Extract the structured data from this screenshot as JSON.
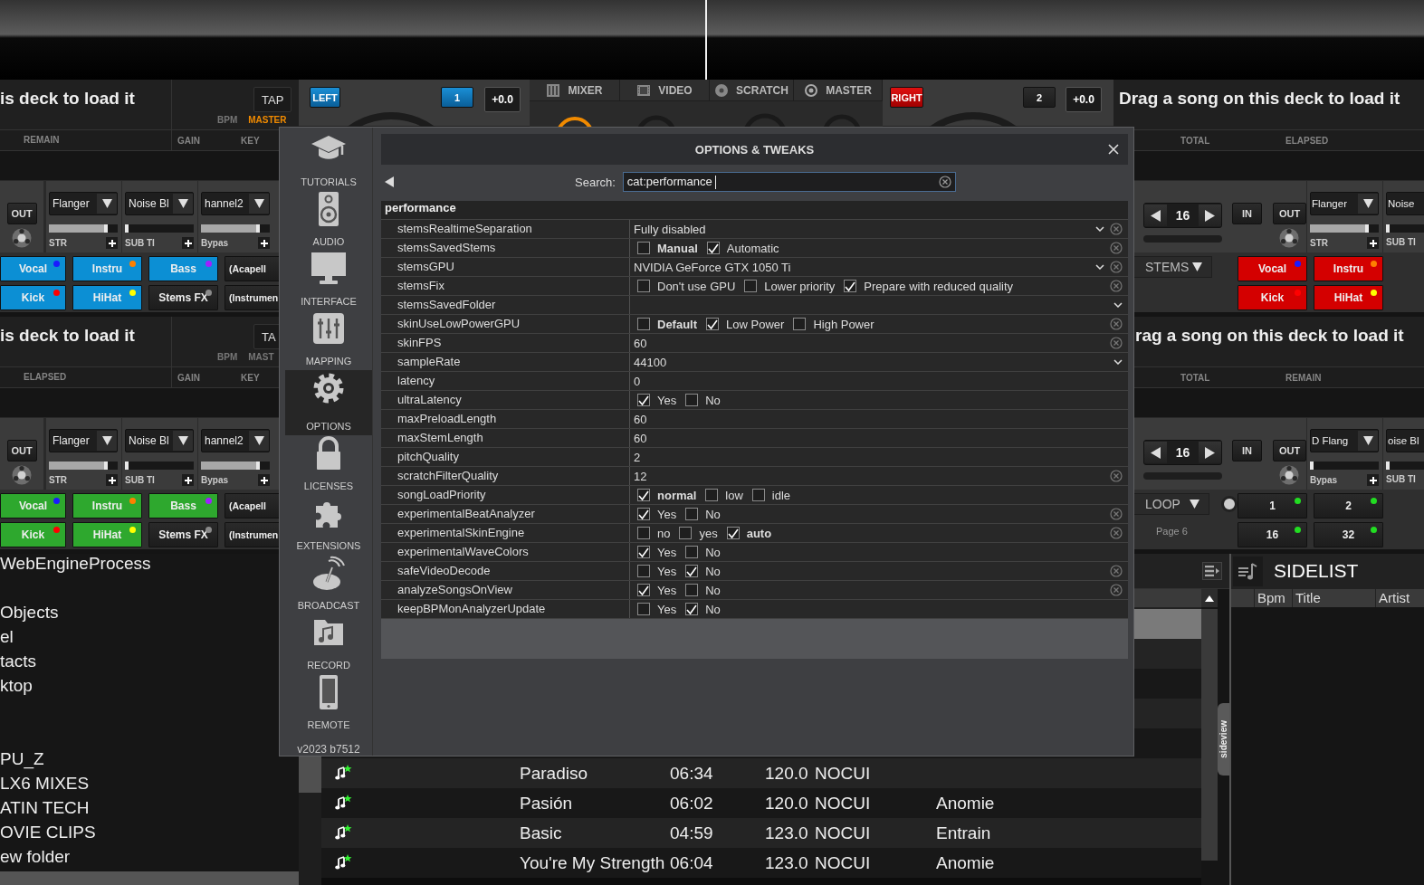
{
  "decks": [
    {
      "color": "#0c8fd4",
      "title": "is deck to load it",
      "tap": "TAP",
      "bpm_label": "BPM",
      "master": "MASTER",
      "master_on": true,
      "time_labels": [
        "REMAIN",
        "GAIN",
        "KEY"
      ],
      "out": "OUT",
      "effects": [
        {
          "name": "Flanger",
          "param": "STR",
          "level": 0.85
        },
        {
          "name": "Noise Bl",
          "param": "SUB TI",
          "level": 0.0
        },
        {
          "name": "hannel2",
          "param": "Bypas",
          "level": 0.85
        }
      ],
      "pads": [
        {
          "label": "Vocal",
          "on": true,
          "color": "#1a1aff"
        },
        {
          "label": "Instru",
          "on": true,
          "color": "#ff8000"
        },
        {
          "label": "Bass",
          "on": true,
          "color": "#a020ff"
        },
        {
          "label": "(Acapell",
          "on": false
        },
        {
          "label": "Kick",
          "on": true,
          "color": "#ff0000"
        },
        {
          "label": "HiHat",
          "on": true,
          "color": "#ffff00"
        },
        {
          "label": "Stems FX",
          "on": false,
          "color": "#8a8a8a"
        },
        {
          "label": "(Instrumen",
          "on": false
        }
      ]
    },
    {
      "color": "#d40000",
      "title": "Drag a song on this deck to load it",
      "time_labels": [
        "TOTAL",
        "ELAPSED"
      ],
      "loop_value": "16",
      "in": "IN",
      "out": "OUT",
      "effects": [
        {
          "name": "Flanger",
          "param": "STR",
          "level": 0.85
        },
        {
          "name": "Noise",
          "param": "SUB TI",
          "level": 0.0
        }
      ],
      "pad_mode": "STEMS",
      "pads": [
        {
          "label": "Vocal",
          "on": true,
          "color": "#1a1aff"
        },
        {
          "label": "Instru",
          "on": true,
          "color": "#ff8000"
        },
        {
          "label": "Kick",
          "on": true,
          "color": "#ff0000"
        },
        {
          "label": "HiHat",
          "on": true,
          "color": "#ffff00"
        }
      ]
    },
    {
      "color": "#2ea82e",
      "title": "is deck to load it",
      "tap": "TA",
      "bpm_label": "BPM",
      "master": "MAST",
      "master_on": false,
      "time_labels": [
        "ELAPSED",
        "GAIN",
        "KEY"
      ],
      "out": "OUT",
      "effects": [
        {
          "name": "Flanger",
          "param": "STR",
          "level": 0.85
        },
        {
          "name": "Noise Bl",
          "param": "SUB TI",
          "level": 0.0
        },
        {
          "name": "hannel2",
          "param": "Bypas",
          "level": 0.85
        }
      ],
      "pads": [
        {
          "label": "Vocal",
          "on": true,
          "color": "#1a1aff"
        },
        {
          "label": "Instru",
          "on": true,
          "color": "#ff8000"
        },
        {
          "label": "Bass",
          "on": true,
          "color": "#a020ff"
        },
        {
          "label": "(Acapell",
          "on": false
        },
        {
          "label": "Kick",
          "on": true,
          "color": "#ff0000"
        },
        {
          "label": "HiHat",
          "on": true,
          "color": "#ffff00"
        },
        {
          "label": "Stems FX",
          "on": false,
          "color": "#8a8a8a"
        },
        {
          "label": "(Instrumen",
          "on": false
        }
      ]
    },
    {
      "title": "rag a song on this deck to load it",
      "time_labels": [
        "TOTAL",
        "REMAIN"
      ],
      "loop_value": "16",
      "in": "IN",
      "out": "OUT",
      "effects": [
        {
          "name": "D Flang",
          "param": "Bypas",
          "level": 0.0
        },
        {
          "name": "oise Bl",
          "param": "SUB TI",
          "level": 0.0
        }
      ],
      "pad_mode": "LOOP",
      "radio_on": true,
      "page_label": "Page 6",
      "pads": [
        {
          "label": "1",
          "on": false,
          "color": "#22dd22"
        },
        {
          "label": "2",
          "on": false,
          "color": "#22dd22"
        },
        {
          "label": "16",
          "on": false,
          "color": "#22dd22"
        },
        {
          "label": "32",
          "on": false,
          "color": "#22dd22"
        }
      ]
    }
  ],
  "mixer": {
    "left": "LEFT",
    "right": "RIGHT",
    "deck_buttons": [
      {
        "label": "1",
        "on": true
      },
      {
        "label": "2",
        "on": false
      }
    ],
    "pitch": [
      "+0.0",
      "+0.0"
    ],
    "tabs": [
      {
        "label": "MIXER",
        "kind": "mixer",
        "selected": false
      },
      {
        "label": "VIDEO",
        "kind": "video",
        "selected": false
      },
      {
        "label": "SCRATCH",
        "kind": "scratch",
        "selected": false
      },
      {
        "label": "MASTER",
        "kind": "master",
        "selected": false
      }
    ]
  },
  "options": {
    "nav": [
      {
        "label": "TUTORIALS",
        "kind": "tutorials",
        "selected": false
      },
      {
        "label": "AUDIO",
        "kind": "audio",
        "selected": false
      },
      {
        "label": "INTERFACE",
        "kind": "interface",
        "selected": false
      },
      {
        "label": "MAPPING",
        "kind": "mapping",
        "selected": false
      },
      {
        "label": "OPTIONS",
        "kind": "options",
        "selected": true
      },
      {
        "label": "LICENSES",
        "kind": "licenses",
        "selected": false
      },
      {
        "label": "EXTENSIONS",
        "kind": "extensions",
        "selected": false
      },
      {
        "label": "BROADCAST",
        "kind": "broadcast",
        "selected": false
      },
      {
        "label": "RECORD",
        "kind": "record",
        "selected": false
      },
      {
        "label": "REMOTE",
        "kind": "remote",
        "selected": false
      }
    ],
    "version": "v2023 b7512",
    "title": "OPTIONS & TWEAKS",
    "search": {
      "label": "Search:",
      "value": "cat:performance"
    },
    "category": "performance",
    "settings": [
      {
        "name": "stemsRealtimeSeparation",
        "kind": "select",
        "value": "Fully disabled",
        "resettable": true
      },
      {
        "name": "stemsSavedStems",
        "kind": "choices",
        "choices": [
          {
            "label": "Manual",
            "default": true,
            "checked": false
          },
          {
            "label": "Automatic",
            "default": false,
            "checked": true
          }
        ],
        "resettable": true
      },
      {
        "name": "stemsGPU",
        "kind": "select",
        "value": "NVIDIA GeForce GTX 1050 Ti",
        "resettable": true
      },
      {
        "name": "stemsFix",
        "kind": "choices",
        "choices": [
          {
            "label": "Don't use GPU",
            "default": false,
            "checked": false
          },
          {
            "label": "Lower priority",
            "default": false,
            "checked": false
          },
          {
            "label": "Prepare with reduced quality",
            "default": false,
            "checked": true
          }
        ],
        "resettable": true
      },
      {
        "name": "stemsSavedFolder",
        "kind": "select",
        "resettable": false
      },
      {
        "name": "skinUseLowPowerGPU",
        "kind": "choices",
        "choices": [
          {
            "label": "Default",
            "default": true,
            "checked": false
          },
          {
            "label": "Low Power",
            "default": false,
            "checked": true
          },
          {
            "label": "High Power",
            "default": false,
            "checked": false
          }
        ],
        "resettable": true
      },
      {
        "name": "skinFPS",
        "kind": "text",
        "value": "60",
        "resettable": true
      },
      {
        "name": "sampleRate",
        "kind": "select",
        "value": "44100",
        "resettable": false
      },
      {
        "name": "latency",
        "kind": "text",
        "value": "0",
        "resettable": false
      },
      {
        "name": "ultraLatency",
        "kind": "choices",
        "choices": [
          {
            "label": "Yes",
            "default": false,
            "checked": true
          },
          {
            "label": "No",
            "default": false,
            "checked": false
          }
        ],
        "resettable": false
      },
      {
        "name": "maxPreloadLength",
        "kind": "text",
        "value": "60",
        "resettable": false
      },
      {
        "name": "maxStemLength",
        "kind": "text",
        "value": "60",
        "resettable": false
      },
      {
        "name": "pitchQuality",
        "kind": "text",
        "value": "2",
        "resettable": false
      },
      {
        "name": "scratchFilterQuality",
        "kind": "text",
        "value": "12",
        "resettable": true
      },
      {
        "name": "songLoadPriority",
        "kind": "choices",
        "choices": [
          {
            "label": "normal",
            "default": true,
            "checked": true
          },
          {
            "label": "low",
            "default": false,
            "checked": false
          },
          {
            "label": "idle",
            "default": false,
            "checked": false
          }
        ],
        "resettable": false
      },
      {
        "name": "experimentalBeatAnalyzer",
        "kind": "choices",
        "choices": [
          {
            "label": "Yes",
            "default": false,
            "checked": true
          },
          {
            "label": "No",
            "default": false,
            "checked": false
          }
        ],
        "resettable": true
      },
      {
        "name": "experimentalSkinEngine",
        "kind": "choices",
        "choices": [
          {
            "label": "no",
            "default": false,
            "checked": false
          },
          {
            "label": "yes",
            "default": false,
            "checked": false
          },
          {
            "label": "auto",
            "default": true,
            "checked": true
          }
        ],
        "resettable": true
      },
      {
        "name": "experimentalWaveColors",
        "kind": "choices",
        "choices": [
          {
            "label": "Yes",
            "default": false,
            "checked": true
          },
          {
            "label": "No",
            "default": false,
            "checked": false
          }
        ],
        "resettable": false
      },
      {
        "name": "safeVideoDecode",
        "kind": "choices",
        "choices": [
          {
            "label": "Yes",
            "default": false,
            "checked": false
          },
          {
            "label": "No",
            "default": false,
            "checked": true
          }
        ],
        "resettable": true
      },
      {
        "name": "analyzeSongsOnView",
        "kind": "choices",
        "choices": [
          {
            "label": "Yes",
            "default": false,
            "checked": true
          },
          {
            "label": "No",
            "default": false,
            "checked": false
          }
        ],
        "resettable": true
      },
      {
        "name": "keepBPMonAnalyzerUpdate",
        "kind": "choices",
        "choices": [
          {
            "label": "Yes",
            "default": false,
            "checked": false
          },
          {
            "label": "No",
            "default": false,
            "checked": true
          }
        ],
        "resettable": false
      }
    ]
  },
  "browser": {
    "folders": [
      {
        "label": "WebEngineProcess",
        "selected": false
      },
      {
        "label": "Objects",
        "selected": false
      },
      {
        "label": "el",
        "selected": false
      },
      {
        "label": "tacts",
        "selected": false
      },
      {
        "label": "ktop",
        "selected": false
      },
      {
        "label": "PU_Z",
        "selected": false
      },
      {
        "label": "LX6 MIXES",
        "selected": false
      },
      {
        "label": "ATIN TECH",
        "selected": false
      },
      {
        "label": "OVIE CLIPS",
        "selected": false
      },
      {
        "label": "ew folder",
        "selected": false
      },
      {
        "selected": true
      }
    ],
    "songs": [
      {
        "selected": true
      },
      {
        "selected": false
      },
      {
        "selected": false
      },
      {
        "selected": false
      },
      {
        "selected": false
      },
      {
        "title": "Paradiso",
        "length": "06:34",
        "bpm": "120.0",
        "genre": "NOCUI",
        "selected": false
      },
      {
        "title": "Pasión",
        "length": "06:02",
        "bpm": "120.0",
        "genre": "NOCUI",
        "artist": "Anomie",
        "selected": false
      },
      {
        "title": "Basic",
        "length": "04:59",
        "bpm": "123.0",
        "genre": "NOCUI",
        "artist": "Entrain",
        "selected": false
      },
      {
        "title": "You're My Strength",
        "length": "06:04",
        "bpm": "123.0",
        "genre": "NOCUI",
        "artist": "Anomie",
        "selected": false
      }
    ],
    "sidelist": {
      "title": "SIDELIST",
      "columns": [
        "Bpm",
        "Title",
        "Artist"
      ]
    },
    "sideview": "sideview"
  }
}
